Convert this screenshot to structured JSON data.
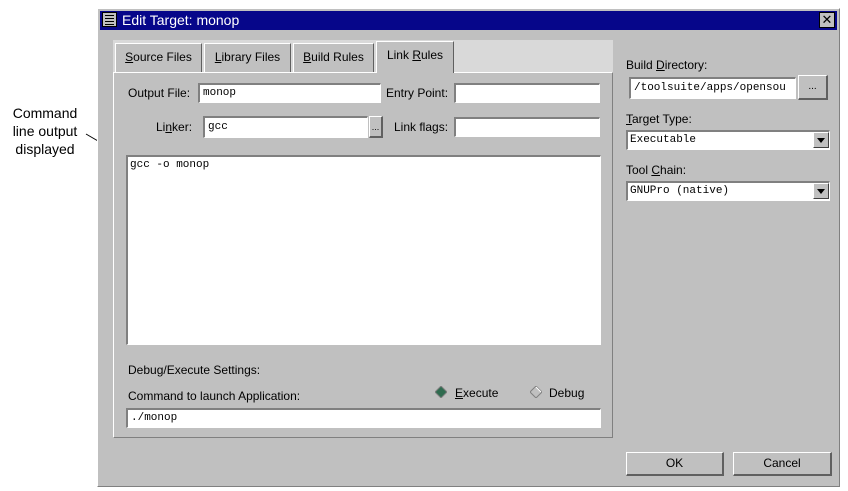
{
  "annotation": {
    "lines": [
      "Command",
      "line output",
      "displayed"
    ]
  },
  "window": {
    "title": "Edit Target: monop",
    "close_glyph": "✕"
  },
  "tabs": [
    {
      "label": "Source Files",
      "underline": "S",
      "rest": "ource Files"
    },
    {
      "label": "Library Files",
      "underline": "L",
      "rest": "ibrary Files"
    },
    {
      "label": "Build Rules",
      "underline": "B",
      "rest": "uild Rules"
    },
    {
      "label": "Link Rules",
      "pre": "Link ",
      "underline": "R",
      "rest": "ules"
    }
  ],
  "link_rules": {
    "output_file_label": "Output File:",
    "output_file_value": "monop",
    "entry_point_label": "Entry Point:",
    "entry_point_value": "",
    "linker_label_pre": "Li",
    "linker_label_u": "n",
    "linker_label_post": "ker:",
    "linker_value": "gcc",
    "linker_browse": "...",
    "link_flags_label": "Link flags:",
    "link_flags_value": "",
    "command_output": "gcc -o monop",
    "debug_settings_label": "Debug/Execute Settings:",
    "launch_label": "Command to launch Application:",
    "launch_value": "./monop",
    "execute_label_u": "E",
    "execute_label_rest": "xecute",
    "debug_label_pre": "Debu",
    "debug_label_u": "g",
    "execute_selected": true
  },
  "right": {
    "build_dir_label_pre": "Build ",
    "build_dir_label_u": "D",
    "build_dir_label_post": "irectory:",
    "build_dir_value": "/toolsuite/apps/opensou",
    "build_dir_browse": "...",
    "target_type_label_u": "T",
    "target_type_label_post": "arget Type:",
    "target_type_value": "Executable",
    "tool_chain_label_pre": "Tool ",
    "tool_chain_label_u": "C",
    "tool_chain_label_post": "hain:",
    "tool_chain_value": "GNUPro (native)"
  },
  "buttons": {
    "ok": "OK",
    "cancel": "Cancel"
  },
  "colors": {
    "titlebar": "#06068a",
    "face": "#c0c0c0",
    "radio_selected": "#2f6b4f"
  }
}
